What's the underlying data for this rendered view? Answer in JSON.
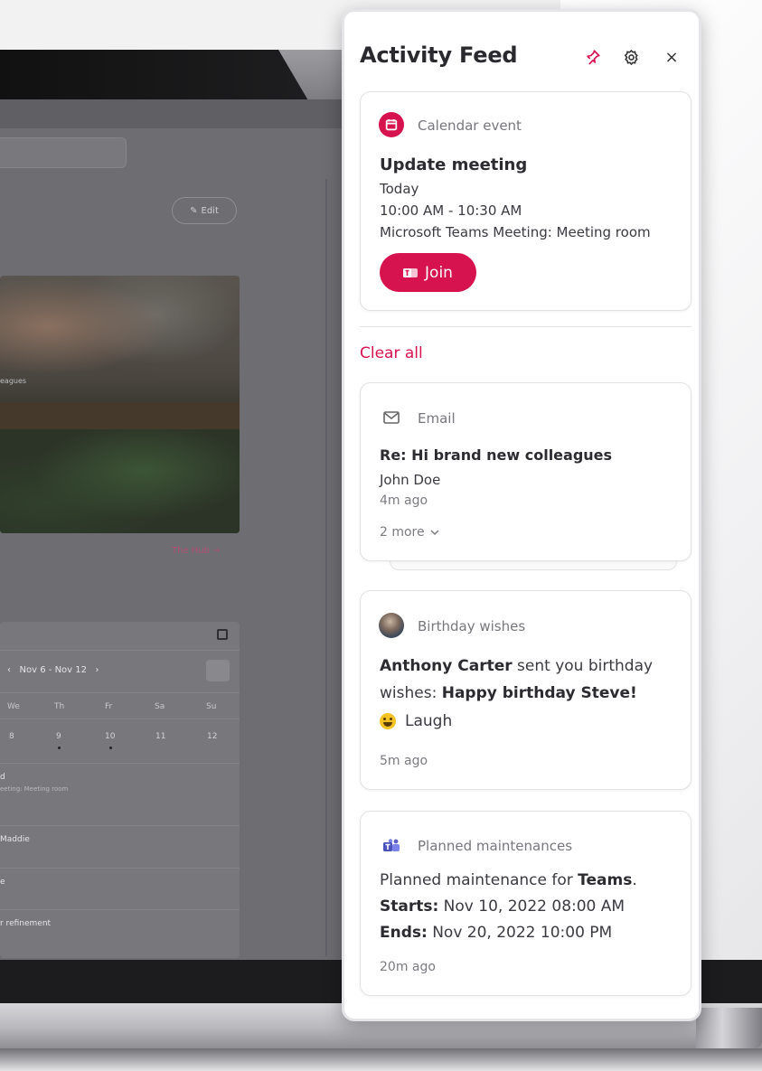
{
  "background": {
    "edit_label": "Edit",
    "photo_caption": "eagues",
    "hub_link": "The Hub →",
    "calendar": {
      "range": "Nov 6 - Nov 12",
      "days": [
        "We",
        "Th",
        "Fr",
        "Sa",
        "Su"
      ],
      "dates": [
        "8",
        "9",
        "10",
        "11",
        "12"
      ],
      "rows": [
        "d",
        "eeting: Meeting room",
        "Maddie",
        "e",
        "r refinement"
      ]
    }
  },
  "panel": {
    "title": "Activity Feed",
    "icons": {
      "pin": "pin-icon",
      "settings": "gear-icon",
      "close": "close-icon"
    },
    "close_glyph": "×",
    "accent_color": "#d6134f",
    "calendar_card": {
      "type": "Calendar event",
      "title": "Update meeting",
      "day": "Today",
      "time": "10:00 AM - 10:30 AM",
      "location": "Microsoft Teams Meeting: Meeting room",
      "join_label": "Join"
    },
    "clear_all": "Clear all",
    "email_card": {
      "type": "Email",
      "title": "Re: Hi brand new colleagues",
      "from": "John Doe",
      "time": "4m ago",
      "more": "2 more"
    },
    "birthday_card": {
      "type": "Birthday wishes",
      "sender": "Anthony Carter",
      "text_mid": " sent you birthday wishes: ",
      "message": "Happy birthday Steve!",
      "reaction": "Laugh",
      "time": "5m ago"
    },
    "maintenance_card": {
      "type": "Planned maintenances",
      "text_prefix": "Planned maintenance for ",
      "service": "Teams",
      "text_suffix": ".",
      "starts_label": "Starts:",
      "starts": " Nov 10, 2022 08:00 AM",
      "ends_label": "Ends:",
      "ends": " Nov 20, 2022 10:00 PM",
      "time": "20m ago"
    }
  }
}
